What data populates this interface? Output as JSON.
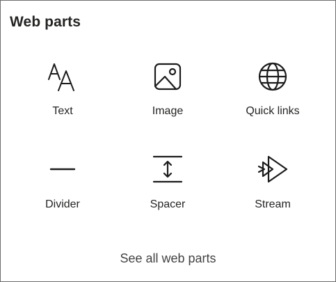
{
  "panel": {
    "title": "Web parts"
  },
  "parts": [
    {
      "label": "Text",
      "icon": "text-format-icon"
    },
    {
      "label": "Image",
      "icon": "image-icon"
    },
    {
      "label": "Quick links",
      "icon": "globe-icon"
    },
    {
      "label": "Divider",
      "icon": "divider-icon"
    },
    {
      "label": "Spacer",
      "icon": "spacer-icon"
    },
    {
      "label": "Stream",
      "icon": "stream-play-icon"
    }
  ],
  "footer": {
    "see_all_label": "See all web parts"
  },
  "colors": {
    "text": "#252423",
    "link": "#424242",
    "icon_stroke": "#1b1b1b",
    "border": "#6b6b6b"
  }
}
